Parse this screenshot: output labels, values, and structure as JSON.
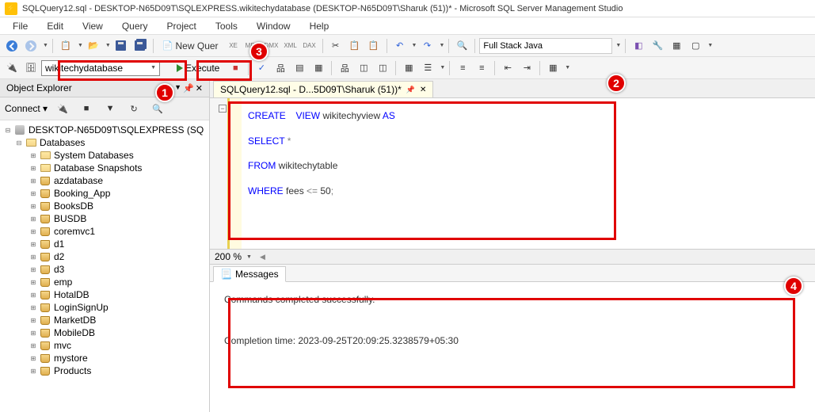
{
  "window": {
    "title": "SQLQuery12.sql - DESKTOP-N65D09T\\SQLEXPRESS.wikitechydatabase (DESKTOP-N65D09T\\Sharuk (51))* - Microsoft SQL Server Management Studio"
  },
  "menubar": [
    "File",
    "Edit",
    "View",
    "Query",
    "Project",
    "Tools",
    "Window",
    "Help"
  ],
  "toolbar1": {
    "new_query_label": "New Quer",
    "launch_dropdown": "Full Stack Java"
  },
  "toolbar2": {
    "database_selected": "wikitechydatabase",
    "execute_label": "Execute"
  },
  "object_explorer": {
    "title": "Object Explorer",
    "connect_label": "Connect ▾",
    "server": "DESKTOP-N65D09T\\SQLEXPRESS (SQ",
    "databases_label": "Databases",
    "system_databases": "System Databases",
    "snapshots": "Database Snapshots",
    "dbs": [
      "azdatabase",
      "Booking_App",
      "BooksDB",
      "BUSDB",
      "coremvc1",
      "d1",
      "d2",
      "d3",
      "emp",
      "HotalDB",
      "LoginSignUp",
      "MarketDB",
      "MobileDB",
      "mvc",
      "mystore",
      "Products"
    ]
  },
  "editor": {
    "tab_label": "SQLQuery12.sql - D...5D09T\\Sharuk (51))*",
    "zoom": "200 %",
    "code": {
      "l1_a": "CREATE",
      "l1_b": "VIEW",
      "l1_c": " wikitechyview ",
      "l1_d": "AS",
      "l2_a": "SELECT",
      "l2_b": " *",
      "l3_a": "FROM",
      "l3_b": " wikitechytable",
      "l4_a": "WHERE",
      "l4_b": " fees ",
      "l4_c": "<=",
      "l4_d": " 50",
      "l4_e": ";"
    }
  },
  "messages": {
    "tab_label": "Messages",
    "line1": "Commands completed successfully.",
    "line2": "Completion time: 2023-09-25T20:09:25.3238579+05:30"
  },
  "annotations": {
    "n1": "1",
    "n2": "2",
    "n3": "3",
    "n4": "4"
  }
}
